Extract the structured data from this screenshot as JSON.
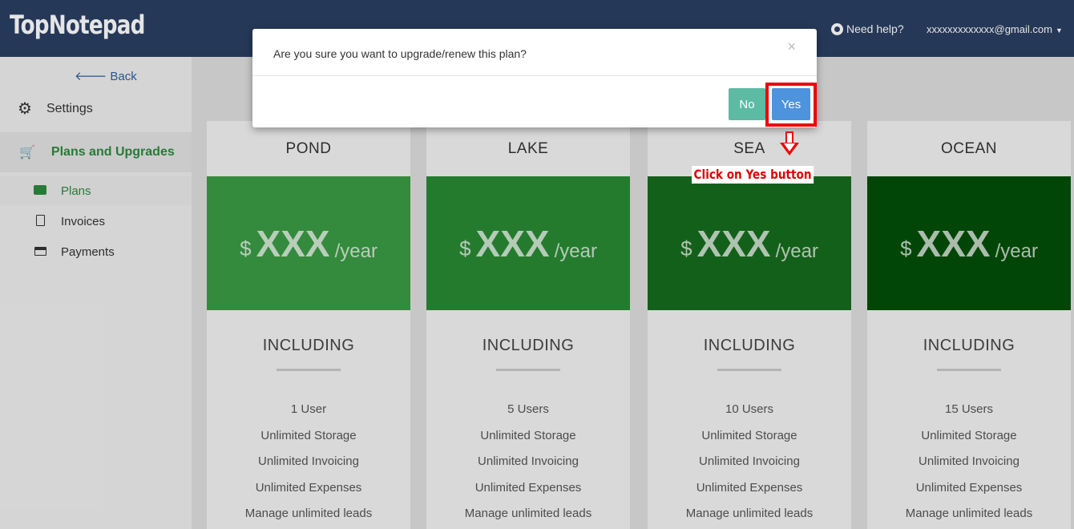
{
  "header": {
    "logo": "TopNotepad",
    "help_label": "Need help?",
    "user_email": "xxxxxxxxxxxxx@gmail.com",
    "background": "#2b3f63"
  },
  "sidebar": {
    "back_label": "Back",
    "settings_label": "Settings",
    "section_label": "Plans and Upgrades",
    "items": [
      {
        "label": "Plans",
        "icon": "briefcase-icon",
        "active": true
      },
      {
        "label": "Invoices",
        "icon": "document-icon",
        "active": false
      },
      {
        "label": "Payments",
        "icon": "credit-card-icon",
        "active": false
      }
    ]
  },
  "plans": [
    {
      "name": "POND",
      "currency": "$",
      "price": "XXX",
      "period": "/year",
      "color": "#3a9a45",
      "including_label": "INCLUDING",
      "features": [
        "1 User",
        "Unlimited Storage",
        "Unlimited Invoicing",
        "Unlimited Expenses",
        "Manage unlimited leads"
      ]
    },
    {
      "name": "LAKE",
      "currency": "$",
      "price": "XXX",
      "period": "/year",
      "color": "#298a34",
      "including_label": "INCLUDING",
      "features": [
        "5 Users",
        "Unlimited Storage",
        "Unlimited Invoicing",
        "Unlimited Expenses",
        "Manage unlimited leads"
      ]
    },
    {
      "name": "SEA",
      "currency": "$",
      "price": "XXX",
      "period": "/year",
      "color": "#166b1d",
      "including_label": "INCLUDING",
      "features": [
        "10 Users",
        "Unlimited Storage",
        "Unlimited Invoicing",
        "Unlimited Expenses",
        "Manage unlimited leads"
      ]
    },
    {
      "name": "OCEAN",
      "currency": "$",
      "price": "XXX",
      "period": "/year",
      "color": "#034e08",
      "including_label": "INCLUDING",
      "features": [
        "15 Users",
        "Unlimited Storage",
        "Unlimited Invoicing",
        "Unlimited Expenses",
        "Manage unlimited leads"
      ]
    }
  ],
  "modal": {
    "question": "Are you sure you want to upgrade/renew this plan?",
    "close_glyph": "×",
    "no_label": "No",
    "yes_label": "Yes",
    "no_color": "#5dbaa3",
    "yes_color": "#4d93de"
  },
  "annotation": {
    "callout_text": "Click on Yes button",
    "color": "#ee0000"
  }
}
